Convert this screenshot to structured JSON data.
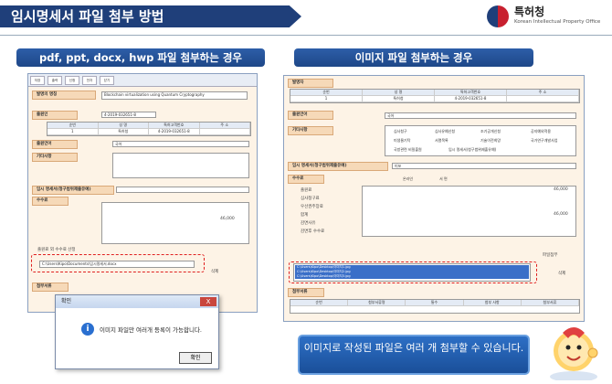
{
  "title": "임시명세서 파일 첨부 방법",
  "logo": {
    "ko": "특허청",
    "en": "Korean Intellectual Property Office"
  },
  "left_panel": {
    "heading": "pdf, ppt, docx, hwp 파일 첨부하는 경우",
    "toolbar": [
      "저장",
      "출력",
      "신청",
      "전자",
      "닫기"
    ],
    "sections": [
      "발명의 명칭",
      "출원인",
      "출원언어",
      "기타사항",
      "임시 명세서(청구범위제출유예)",
      "수수료",
      "첨부서류"
    ],
    "invention_title": "Blockchain virtualization using Quantum Cryptography",
    "applicant_no": "4-2019-032651-8",
    "app_table_head": [
      "순번",
      "성 명",
      "특허고객번호",
      "주 소"
    ],
    "app_table_row": [
      "1",
      "특허청",
      "4-2019-032651-8",
      ""
    ],
    "lang": "국어",
    "attach_file": "C:\\Users\\Kipo\\Documents\\임시명세서.docx",
    "fee_total": "46,000",
    "tiny_label": "출원료 외 수수료 산정",
    "delete": "삭제",
    "dialog": {
      "title": "확인",
      "message": "이미지 파일만 여러개 등록이 가능합니다.",
      "ok": "확인",
      "close": "X"
    }
  },
  "right_panel": {
    "heading": "이미지 파일 첨부하는 경우",
    "sections": [
      "발명자",
      "출원언어",
      "기타사항",
      "임시 명세서(청구범위제출유예)",
      "수수료",
      "첨부서류"
    ],
    "inventor_table_head": [
      "순번",
      "성 명",
      "특허고객번호",
      "주 소"
    ],
    "inventor_table_row": [
      "1",
      "특허청",
      "4-2019-032651-8",
      ""
    ],
    "lang": "국어",
    "other_items": [
      "심사청구",
      "심사유예신청",
      "조기공개신청",
      "공지예외적용",
      "미생물기탁",
      "서열목록",
      "기술이전희망",
      "국가연구개발사업",
      "국방관련 비밀출원",
      "임시 명세서(청구범위제출유예)"
    ],
    "spec_value": "미포",
    "fee_radio": [
      "온라인",
      "서 면"
    ],
    "fee_rows": [
      "출원료",
      "심사청구료",
      "우선권주장료",
      "합계",
      "감면사유",
      "감면후 수수료"
    ],
    "fee_amount": "46,000",
    "files": [
      "C:\\Users\\Kipo\\Desktop\\이미지1.jpg",
      "C:\\Users\\Kipo\\Desktop\\이미지2.jpg",
      "C:\\Users\\Kipo\\Desktop\\이미지3.jpg"
    ],
    "attach_btn": "파일첨부",
    "delete": "삭제",
    "att_table_head": [
      "순번",
      "첨부서류명",
      "통수",
      "첨부 사항",
      "첨부서류"
    ]
  },
  "callout": "이미지로 작성된 파일은 여러 개 첨부할 수 있습니다."
}
